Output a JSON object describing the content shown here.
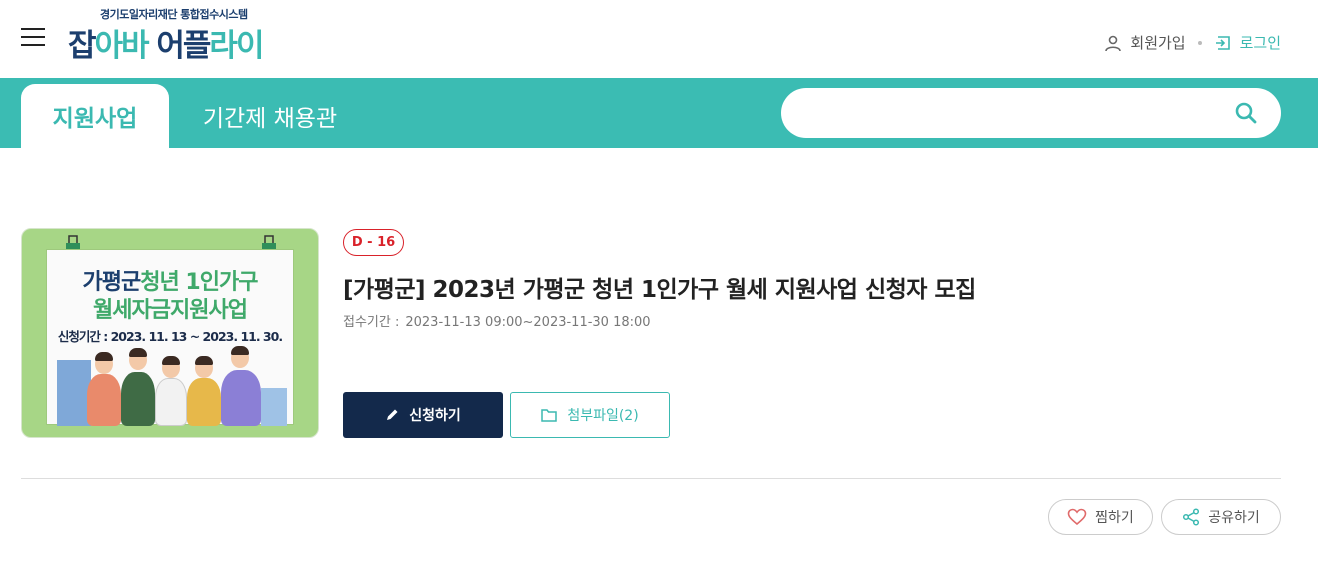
{
  "header": {
    "logo_subtitle": "경기도일자리재단 통합접수시스템",
    "logo_part1": "잡",
    "logo_part2": "아바",
    "logo_part3": "어플",
    "logo_part4": "라이",
    "signup_label": "회원가입",
    "login_label": "로그인"
  },
  "nav": {
    "tabs": [
      {
        "label": "지원사업",
        "active": true
      },
      {
        "label": "기간제 채용관",
        "active": false
      }
    ],
    "search_placeholder": ""
  },
  "listing": {
    "thumbnail": {
      "line1_a": "가평군",
      "line1_b": "청년 1인가구",
      "line2": "월세자금지원사업",
      "line3": "신청기간 : 2023. 11. 13 ~ 2023. 11. 30."
    },
    "dday": "D - 16",
    "title": "[가평군] 2023년 가평군 청년 1인가구 월세 지원사업 신청자 모집",
    "period_label": "접수기간 :",
    "period_value": "2023-11-13 09:00~2023-11-30 18:00",
    "apply_label": "신청하기",
    "attachment_label": "첨부파일(2)"
  },
  "actions": {
    "like_label": "찜하기",
    "share_label": "공유하기"
  },
  "colors": {
    "teal": "#3bbcb3",
    "navy": "#13294b",
    "dday_red": "#d9222a"
  },
  "icons": [
    "menu-icon",
    "user-icon",
    "login-icon",
    "search-icon",
    "pencil-icon",
    "folder-icon",
    "heart-icon",
    "share-icon"
  ]
}
